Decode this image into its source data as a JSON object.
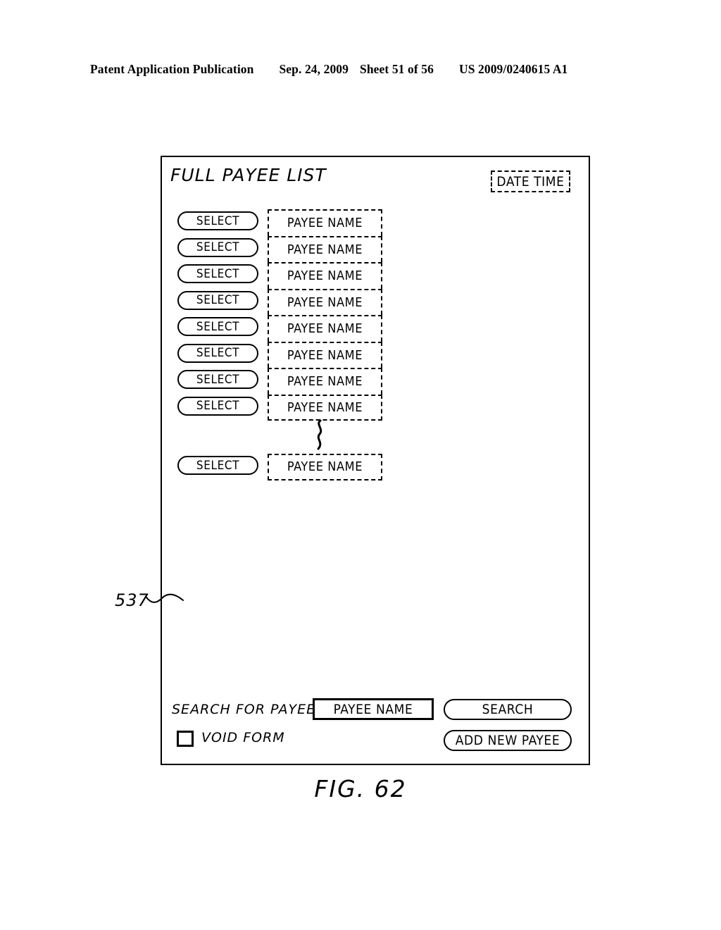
{
  "page_header": {
    "publication": "Patent Application Publication",
    "date": "Sep. 24, 2009",
    "sheet": "Sheet 51 of 56",
    "patent_number": "US 2009/0240615 A1"
  },
  "figure": {
    "caption": "FIG. 62",
    "reference_numeral": "537"
  },
  "screen": {
    "title": "FULL PAYEE LIST",
    "datetime_label": "DATE TIME",
    "select_button_label": "SELECT",
    "payee_name_label": "PAYEE NAME",
    "rows": [
      {
        "select": "SELECT",
        "payee": "PAYEE NAME"
      },
      {
        "select": "SELECT",
        "payee": "PAYEE NAME"
      },
      {
        "select": "SELECT",
        "payee": "PAYEE NAME"
      },
      {
        "select": "SELECT",
        "payee": "PAYEE NAME"
      },
      {
        "select": "SELECT",
        "payee": "PAYEE NAME"
      },
      {
        "select": "SELECT",
        "payee": "PAYEE NAME"
      },
      {
        "select": "SELECT",
        "payee": "PAYEE NAME"
      },
      {
        "select": "SELECT",
        "payee": "PAYEE NAME"
      }
    ],
    "continuation_row": {
      "select": "SELECT",
      "payee": "PAYEE NAME"
    },
    "form": {
      "search_label": "SEARCH FOR PAYEE",
      "search_value": "PAYEE NAME",
      "search_button": "SEARCH",
      "add_button": "ADD NEW PAYEE",
      "void_label": "VOID FORM",
      "void_checked": false
    }
  }
}
